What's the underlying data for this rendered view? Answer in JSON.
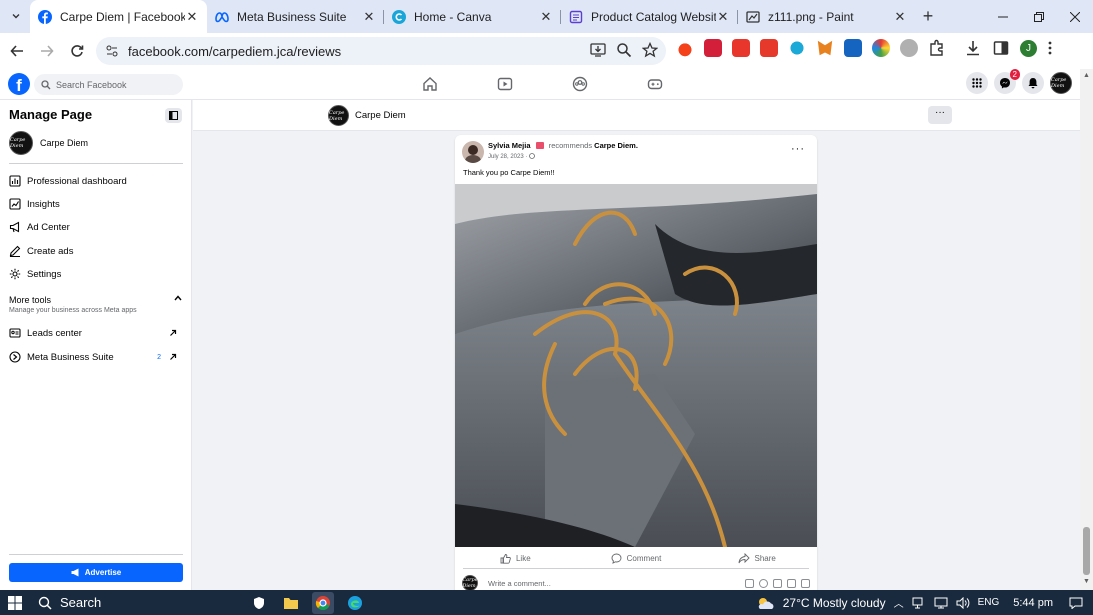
{
  "browser": {
    "tabs": [
      {
        "title": "Carpe Diem | Facebook",
        "active": true,
        "icon": "facebook-icon"
      },
      {
        "title": "Meta Business Suite",
        "active": false,
        "icon": "meta-icon"
      },
      {
        "title": "Home - Canva",
        "active": false,
        "icon": "canva-icon"
      },
      {
        "title": "Product Catalog Website in",
        "active": false,
        "icon": "document-icon"
      },
      {
        "title": "z111.png - Paint",
        "active": false,
        "icon": "paint-icon"
      }
    ],
    "close_glyph": "✕",
    "url": "facebook.com/carpediem.jca/reviews",
    "profile_initial": "J"
  },
  "fb": {
    "search_placeholder": "Search Facebook",
    "notification_count": "2",
    "logo_letter": "f"
  },
  "sidebar": {
    "title": "Manage Page",
    "page_name": "Carpe Diem",
    "items": [
      {
        "label": "Professional dashboard"
      },
      {
        "label": "Insights"
      },
      {
        "label": "Ad Center"
      },
      {
        "label": "Create ads"
      },
      {
        "label": "Settings"
      }
    ],
    "more_tools": "More tools",
    "more_tools_sub": "Manage your business across Meta apps",
    "leads_center": "Leads center",
    "meta_business_suite": "Meta Business Suite",
    "mbs_count": "2",
    "advertise": "Advertise"
  },
  "pagebar": {
    "page_name": "Carpe Diem",
    "avatar_text": "Carpe Diem"
  },
  "post": {
    "author": "Sylvia Mejia",
    "verb": "recommends",
    "target": "Carpe Diem.",
    "date": "July 28, 2023 · ",
    "text": "Thank you po Carpe Diem!!",
    "like": "Like",
    "comment": "Comment",
    "share": "Share",
    "comment_placeholder": "Write a comment..."
  },
  "taskbar": {
    "search": "Search",
    "weather": "27°C  Mostly cloudy",
    "lang": "ENG",
    "time": "5:44 pm"
  },
  "colors": {
    "fb_blue": "#0866ff",
    "tabbar_bg": "#dfe7f7",
    "taskbar_bg": "#1a2a3e"
  }
}
